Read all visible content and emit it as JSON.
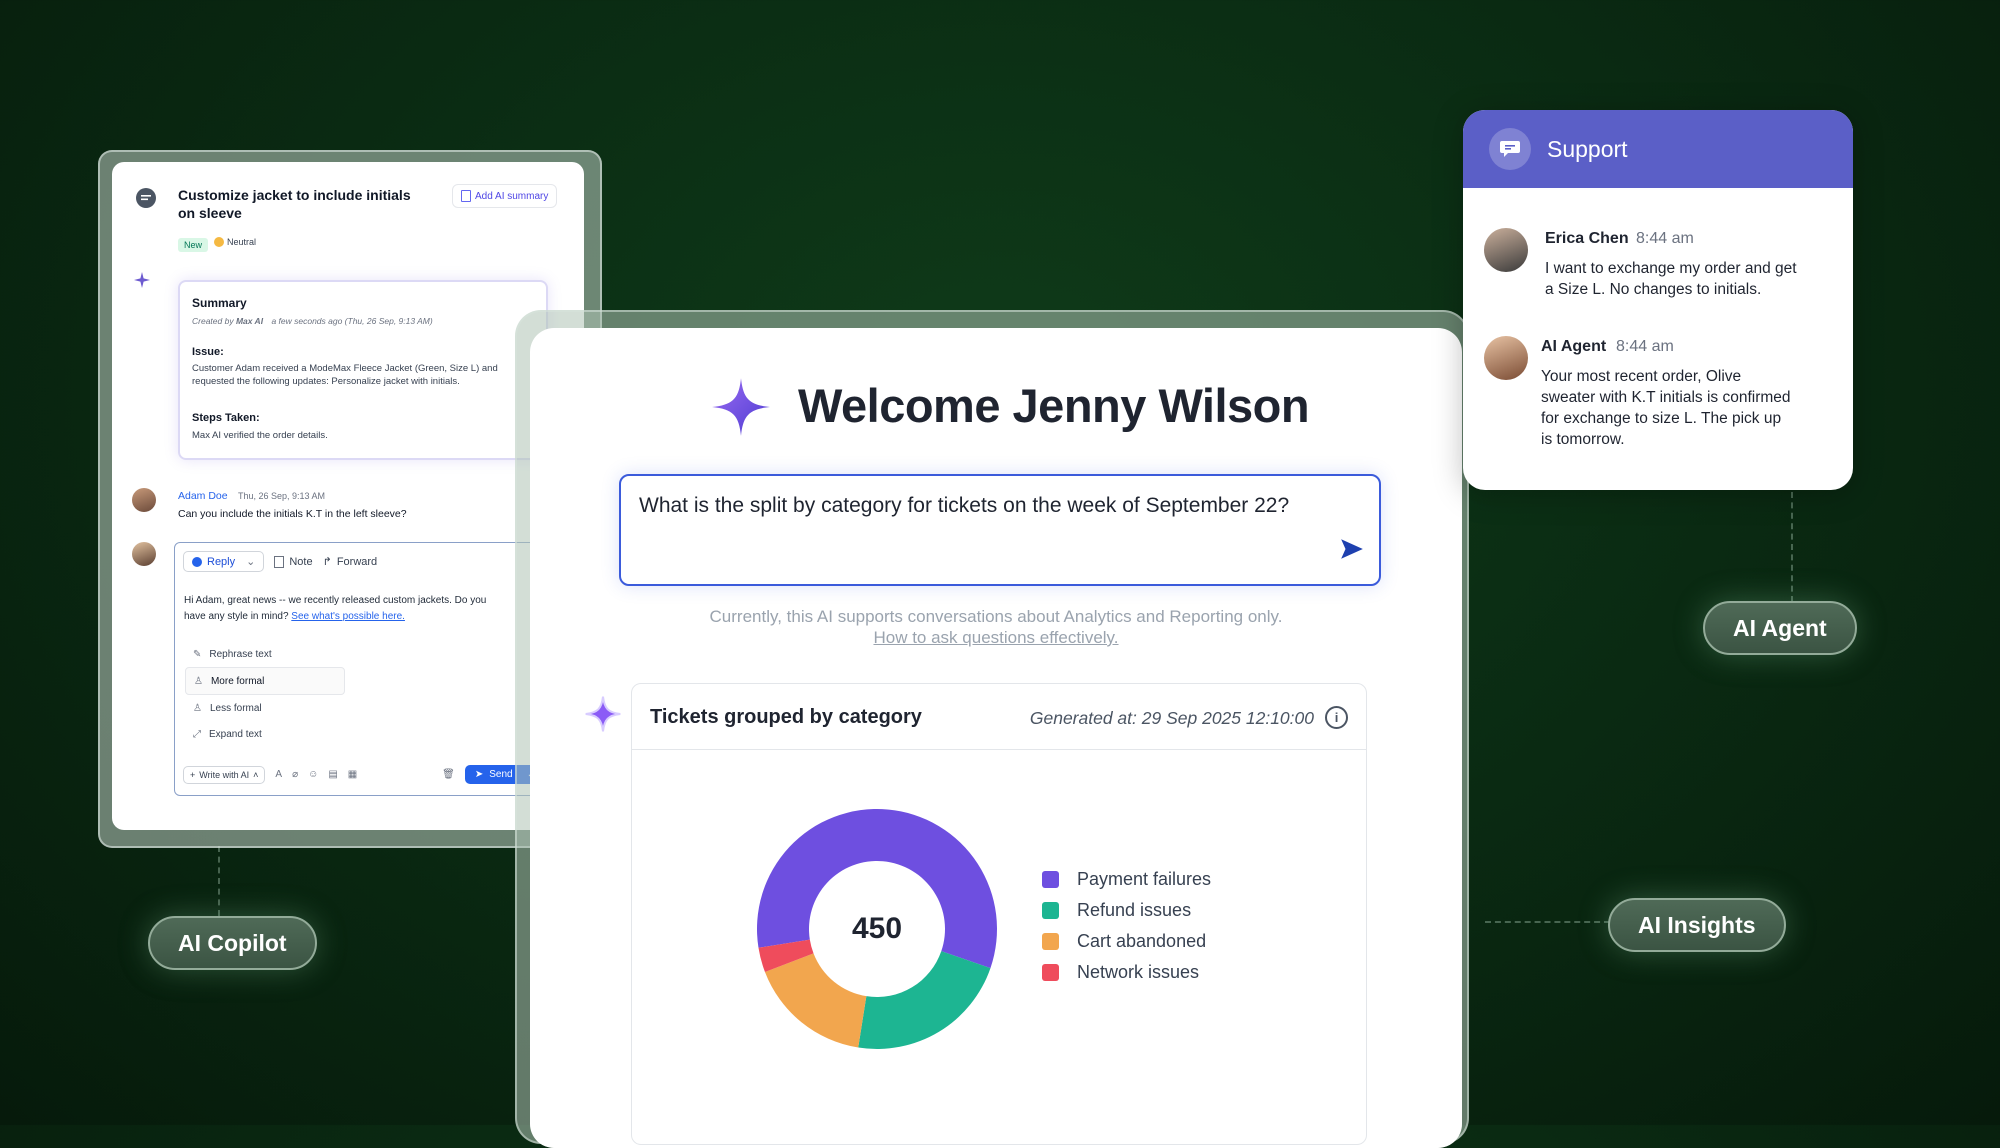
{
  "pills": {
    "copilot": "AI Copilot",
    "agent": "AI Agent",
    "insights": "AI Insights"
  },
  "copilot": {
    "ticket_title": "Customize jacket to include initials on sleeve",
    "add_summary": "Add AI summary",
    "badge_new": "New",
    "badge_neutral": "Neutral",
    "summary": {
      "heading": "Summary",
      "created_by": "Created by",
      "author": "Max AI",
      "time": "a few seconds ago (Thu, 26 Sep, 9:13 AM)",
      "issue_heading": "Issue:",
      "issue_text": "Customer Adam received a ModeMax Fleece Jacket (Green, Size L) and requested the following updates: Personalize jacket with initials.",
      "steps_heading": "Steps Taken:",
      "steps_text": "Max AI verified the order details."
    },
    "message": {
      "author": "Adam Doe",
      "time": "Thu, 26 Sep, 9:13 AM",
      "text": "Can you include the initials K.T in the left sleeve?"
    },
    "composer": {
      "tab_reply": "Reply",
      "tab_note": "Note",
      "tab_forward": "Forward",
      "draft_text": "Hi Adam, great news -- we recently released custom jackets. Do you have any style in mind?",
      "draft_link": "See what's possible here.",
      "menu": [
        "Rephrase text",
        "More formal",
        "Less formal",
        "Expand text"
      ],
      "write_ai": "Write with AI",
      "send": "Send"
    }
  },
  "main": {
    "welcome": "Welcome Jenny Wilson",
    "query": "What is the split by category for tickets on the week of September 22?",
    "note": "Currently, this AI supports conversations about Analytics and Reporting only.",
    "note_link": "How to ask questions effectively.",
    "card_title": "Tickets grouped by category",
    "generated": "Generated at: 29 Sep 2025 12:10:00"
  },
  "chart_data": {
    "type": "pie",
    "title": "Tickets grouped by category",
    "center_label": "450",
    "categories": [
      "Payment failures",
      "Refund issues",
      "Cart abandoned",
      "Network issues"
    ],
    "values": [
      260,
      100,
      75,
      15
    ],
    "colors": [
      "#6e4fe0",
      "#1db592",
      "#f2a64e",
      "#ef4c5c"
    ]
  },
  "support": {
    "title": "Support",
    "messages": [
      {
        "name": "Erica Chen",
        "time": "8:44 am",
        "text": "I want to exchange my order and get a Size L. No changes to initials."
      },
      {
        "name": "AI Agent",
        "time": "8:44 am",
        "text": "Your most recent order, Olive sweater with K.T initials is confirmed for exchange to size L. The pick up is tomorrow."
      }
    ]
  }
}
